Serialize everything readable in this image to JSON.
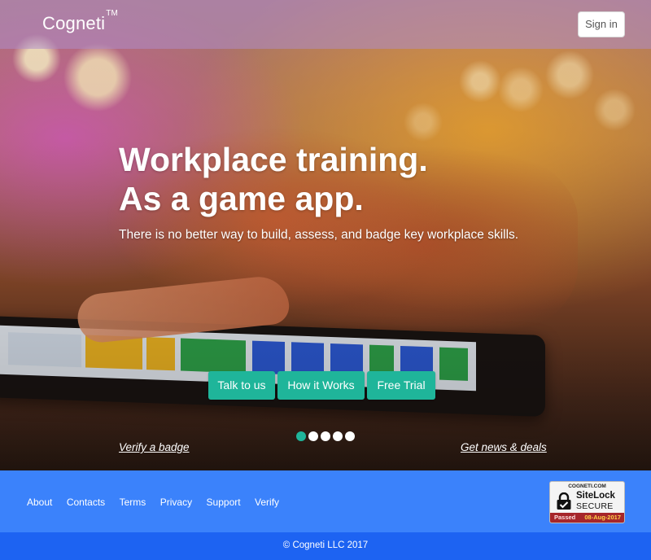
{
  "header": {
    "logo_text": "Cogneti",
    "logo_tm": "TM",
    "signin_label": "Sign in"
  },
  "hero": {
    "headline_line1": "Workplace training.",
    "headline_line2": "As a game app.",
    "subheadline": "There is no better way to build, assess, and badge key workplace skills.",
    "buttons": [
      {
        "label": "Talk to us"
      },
      {
        "label": "How it Works"
      },
      {
        "label": "Free Trial"
      }
    ],
    "carousel": {
      "slide_count": 5,
      "active_index": 0
    },
    "links": {
      "verify_badge": "Verify a badge",
      "news_deals": "Get news & deals"
    }
  },
  "footer": {
    "nav": [
      "About",
      "Contacts",
      "Terms",
      "Privacy",
      "Support",
      "Verify"
    ],
    "sitelock": {
      "site": "COGNETI.COM",
      "brand": "SiteLock",
      "status": "SECURE",
      "passed": "Passed",
      "date": "08-Aug-2017"
    },
    "copyright": "© Cogneti LLC 2017"
  },
  "colors": {
    "accent": "#1fb59a",
    "footer_bg": "#3b82fb",
    "footer_bottom_bg": "#1d63f2",
    "sitelock_bar": "#a6262b"
  },
  "icons": {
    "sitelock_badge": "lock-checkmark-icon"
  }
}
